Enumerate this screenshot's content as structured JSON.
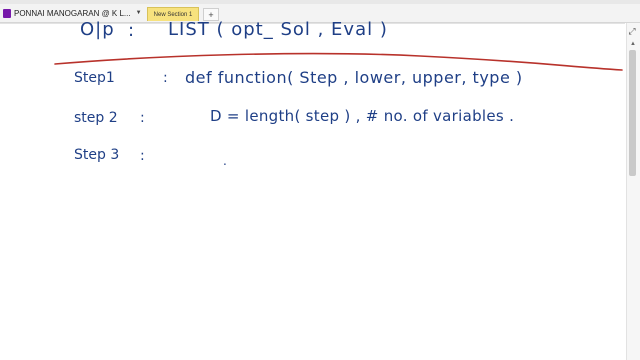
{
  "tabbar": {
    "notebook_name": "PONNAI MANOGARAN @ K L...",
    "section_tab": "New Section 1",
    "add_tab": "+"
  },
  "icons": {
    "notebook": "notebook-icon",
    "dropdown": "chevron-down-icon",
    "expand": "expand-icon",
    "scroll_up": "chevron-up-icon"
  },
  "colors": {
    "ink": "#1f3f86",
    "underline": "#b8322b",
    "section_tab": "#f7e27e",
    "notebook": "#7719aa"
  },
  "notes": {
    "op_label": "O|p",
    "op_colon": ":",
    "op_value": "LIST ( opt_ Sol , Eval )",
    "step1_label": "Step1",
    "step1_colon": ":",
    "step1_value": "def function( Step , lower, upper, type )",
    "step2_label": "step 2",
    "step2_colon": ":",
    "step2_value": "D = length( step )   , # no. of variables .",
    "step3_label": "Step 3",
    "step3_colon": ":",
    "step3_value": "."
  }
}
